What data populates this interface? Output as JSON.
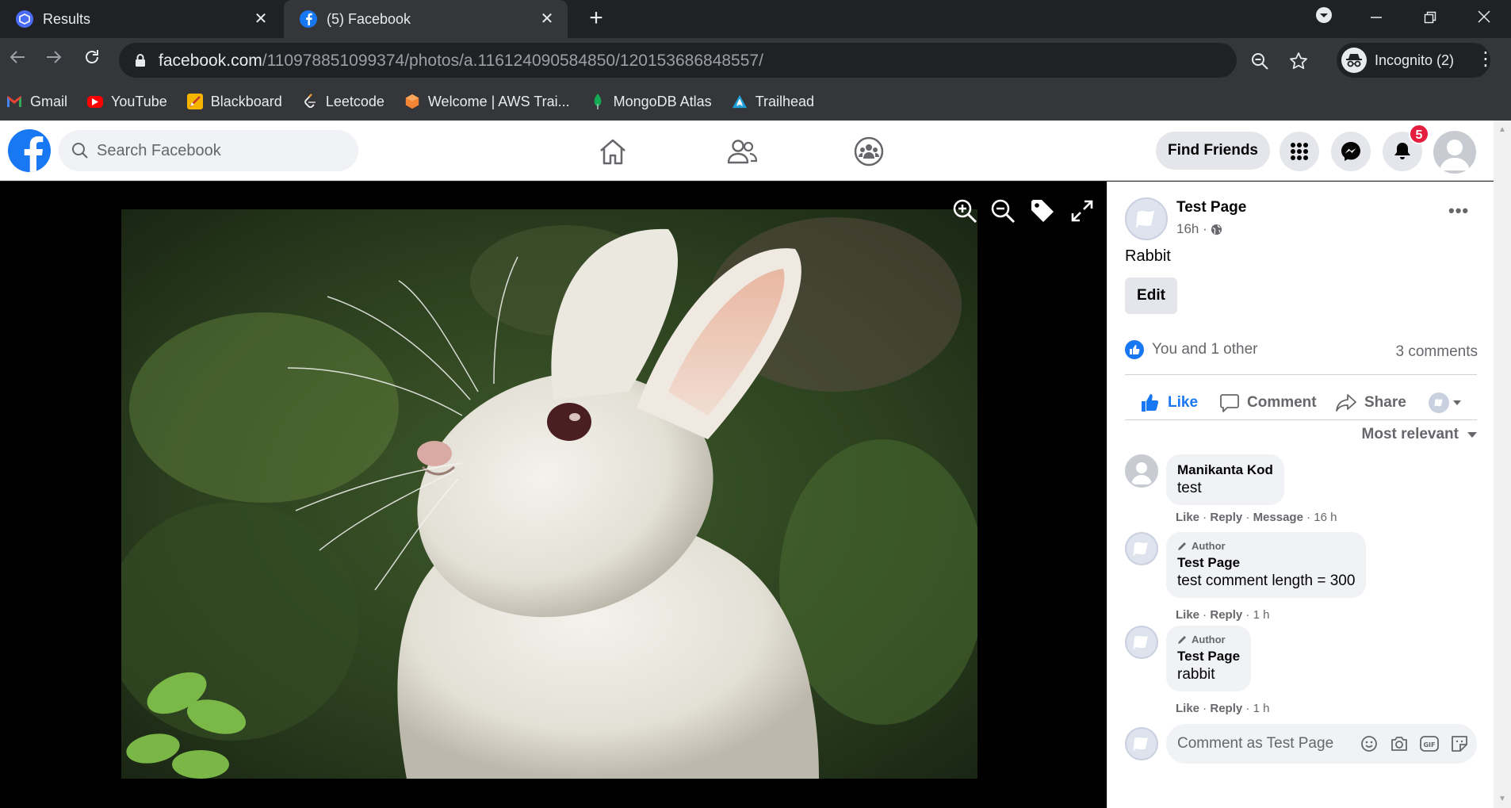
{
  "browser": {
    "tabs": [
      {
        "title": "Results"
      },
      {
        "title": "(5) Facebook"
      }
    ],
    "url_host": "facebook.com",
    "url_path": "/110978851099374/photos/a.116124090584850/120153686848557/",
    "incognito_label": "Incognito (2)",
    "bookmarks": [
      {
        "label": "Gmail"
      },
      {
        "label": "YouTube"
      },
      {
        "label": "Blackboard"
      },
      {
        "label": "Leetcode"
      },
      {
        "label": "Welcome | AWS Trai..."
      },
      {
        "label": "MongoDB Atlas"
      },
      {
        "label": "Trailhead"
      }
    ]
  },
  "facebook": {
    "search_placeholder": "Search Facebook",
    "find_friends": "Find Friends",
    "notification_count": "5"
  },
  "post": {
    "page_name": "Test Page",
    "time": "16h · ",
    "caption": "Rabbit",
    "edit_label": "Edit",
    "reactions_text": "You and 1 other",
    "comments_count": "3 comments",
    "actions": {
      "like": "Like",
      "comment": "Comment",
      "share": "Share"
    },
    "sort_label": "Most relevant",
    "comments": [
      {
        "author_badge": "",
        "name": "Manikanta Kod",
        "text": "test",
        "meta_like": "Like",
        "meta_reply": "Reply",
        "meta_extra": "Message",
        "time": "16 h"
      },
      {
        "author_badge": "Author",
        "name": "Test Page",
        "text": "test comment length = 300",
        "meta_like": "Like",
        "meta_reply": "Reply",
        "time": "1 h"
      },
      {
        "author_badge": "Author",
        "name": "Test Page",
        "text": "rabbit",
        "meta_like": "Like",
        "meta_reply": "Reply",
        "time": "1 h"
      }
    ],
    "comment_placeholder": "Comment as Test Page"
  }
}
